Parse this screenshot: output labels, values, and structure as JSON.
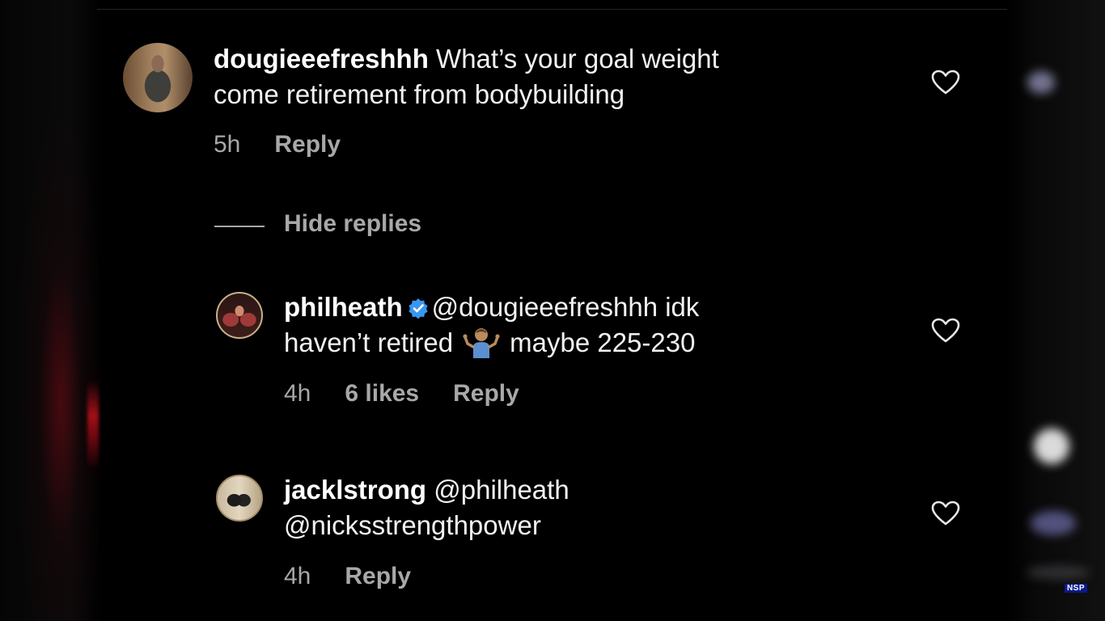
{
  "comments": [
    {
      "username": "dougieeefreshhh",
      "line1": "What’s your goal weight",
      "line2": "come retirement from bodybuilding",
      "time": "5h",
      "reply_label": "Reply",
      "avatar_icon": "user-avatar"
    }
  ],
  "hide_replies_label": "Hide replies",
  "replies": [
    {
      "username": "philheath",
      "verified": true,
      "line1": "@dougieeefreshhh idk",
      "line2a": "haven’t retired",
      "emoji": "person-shrugging-emoji",
      "line2b": "maybe 225-230",
      "time": "4h",
      "likes": "6 likes",
      "reply_label": "Reply"
    },
    {
      "username": "jacklstrong",
      "line1": "@philheath",
      "line2": "@nicksstrengthpower",
      "time": "4h",
      "reply_label": "Reply"
    }
  ],
  "watermark": "NSP",
  "colors": {
    "background": "#000000",
    "text": "#f2f2f2",
    "muted": "#a8a8a8",
    "verified": "#3897f0"
  }
}
